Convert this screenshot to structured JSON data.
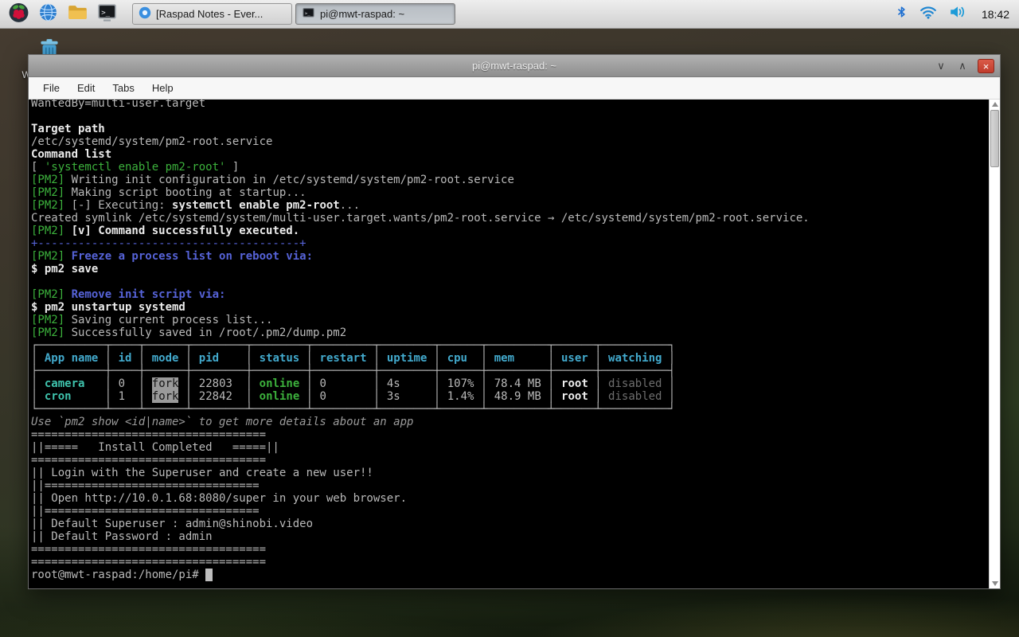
{
  "colors": {
    "terminal_bg": "#000000",
    "terminal_fg": "#b9b9b9",
    "green": "#3cb13c",
    "blue": "#5663d8",
    "cyan": "#42a9cc",
    "dim_gray": "#6e6e6e",
    "close_button_red": "#c03c2c",
    "taskbar_gray": "#d9d9d9"
  },
  "desktop": {
    "wastebasket_label": "Wastebasket"
  },
  "taskbar": {
    "clock": "18:42",
    "windows": [
      {
        "label": "[Raspad Notes - Ever...",
        "active": false
      },
      {
        "label": "pi@mwt-raspad: ~",
        "active": true
      }
    ]
  },
  "window": {
    "title": "pi@mwt-raspad: ~",
    "menu": [
      "File",
      "Edit",
      "Tabs",
      "Help"
    ],
    "controls": {
      "minimize": "∨",
      "maximize": "∧",
      "close": "×"
    }
  },
  "terminal": {
    "prompt": "root@mwt-raspad:/home/pi#",
    "lines": [
      [
        {
          "t": "WantedBy=multi-user.target"
        }
      ],
      [],
      [
        {
          "t": "Target path",
          "c": "bold"
        }
      ],
      [
        {
          "t": "/etc/systemd/system/pm2-root.service"
        }
      ],
      [
        {
          "t": "Command list",
          "c": "bold"
        }
      ],
      [
        {
          "t": "[ "
        },
        {
          "t": "'systemctl enable pm2-root'",
          "c": "grn"
        },
        {
          "t": " ]"
        }
      ],
      [
        {
          "t": "[PM2] ",
          "c": "grn"
        },
        {
          "t": "Writing init configuration in /etc/systemd/system/pm2-root.service"
        }
      ],
      [
        {
          "t": "[PM2] ",
          "c": "grn"
        },
        {
          "t": "Making script booting at startup..."
        }
      ],
      [
        {
          "t": "[PM2] ",
          "c": "grn"
        },
        {
          "t": "[-] Executing: "
        },
        {
          "t": "systemctl enable pm2-root",
          "c": "bold"
        },
        {
          "t": "..."
        }
      ],
      [
        {
          "t": "Created symlink /etc/systemd/system/multi-user.target.wants/pm2-root.service → /etc/systemd/system/pm2-root.service."
        }
      ],
      [
        {
          "t": "[PM2] ",
          "c": "grn"
        },
        {
          "t": "[v] Command successfully executed.",
          "c": "bold"
        }
      ],
      [
        {
          "t": "+---------------------------------------+",
          "c": "blu"
        }
      ],
      [
        {
          "t": "[PM2] ",
          "c": "grn"
        },
        {
          "t": "Freeze a process list on reboot via:",
          "c": "blub"
        }
      ],
      [
        {
          "t": "$ pm2 save",
          "c": "bold"
        }
      ],
      [],
      [
        {
          "t": "[PM2] ",
          "c": "grn"
        },
        {
          "t": "Remove init script via:",
          "c": "blub"
        }
      ],
      [
        {
          "t": "$ pm2 unstartup systemd",
          "c": "bold"
        }
      ],
      [
        {
          "t": "[PM2] ",
          "c": "grn"
        },
        {
          "t": "Saving current process list..."
        }
      ],
      [
        {
          "t": "[PM2] ",
          "c": "grn"
        },
        {
          "t": "Successfully saved in /root/.pm2/dump.pm2"
        }
      ],
      [
        {
          "t": "┌──────────┬────┬──────┬────────┬────────┬─────────┬────────┬──────┬─────────┬──────┬──────────┐"
        }
      ],
      [
        {
          "t": "│"
        },
        {
          "t": " App name ",
          "c": "cy"
        },
        {
          "t": "│"
        },
        {
          "t": " id ",
          "c": "cy"
        },
        {
          "t": "│"
        },
        {
          "t": " mode ",
          "c": "cy"
        },
        {
          "t": "│"
        },
        {
          "t": " pid    ",
          "c": "cy"
        },
        {
          "t": "│"
        },
        {
          "t": " status ",
          "c": "cy"
        },
        {
          "t": "│"
        },
        {
          "t": " restart ",
          "c": "cy"
        },
        {
          "t": "│"
        },
        {
          "t": " uptime ",
          "c": "cy"
        },
        {
          "t": "│"
        },
        {
          "t": " cpu  ",
          "c": "cy"
        },
        {
          "t": "│"
        },
        {
          "t": " mem     ",
          "c": "cy"
        },
        {
          "t": "│"
        },
        {
          "t": " user ",
          "c": "cy"
        },
        {
          "t": "│"
        },
        {
          "t": " watching ",
          "c": "cy"
        },
        {
          "t": "│"
        }
      ],
      [
        {
          "t": "├──────────┼────┼──────┼────────┼────────┼─────────┼────────┼──────┼─────────┼──────┼──────────┤"
        }
      ],
      [
        {
          "t": "│"
        },
        {
          "t": " camera   ",
          "c": "cyb"
        },
        {
          "t": "│"
        },
        {
          "t": " 0  "
        },
        {
          "t": "│"
        },
        {
          "t": " "
        },
        {
          "t": "fork",
          "c": "inv"
        },
        {
          "t": " "
        },
        {
          "t": "│"
        },
        {
          "t": " 22803  "
        },
        {
          "t": "│"
        },
        {
          "t": " "
        },
        {
          "t": "online",
          "c": "grnb"
        },
        {
          "t": " "
        },
        {
          "t": "│"
        },
        {
          "t": " 0       "
        },
        {
          "t": "│"
        },
        {
          "t": " 4s     "
        },
        {
          "t": "│"
        },
        {
          "t": " 107% "
        },
        {
          "t": "│"
        },
        {
          "t": " 78.4 MB "
        },
        {
          "t": "│"
        },
        {
          "t": " root ",
          "c": "bold"
        },
        {
          "t": "│"
        },
        {
          "t": " disabled ",
          "c": "dim"
        },
        {
          "t": "│"
        }
      ],
      [
        {
          "t": "│"
        },
        {
          "t": " cron     ",
          "c": "cyb"
        },
        {
          "t": "│"
        },
        {
          "t": " 1  "
        },
        {
          "t": "│"
        },
        {
          "t": " "
        },
        {
          "t": "fork",
          "c": "inv"
        },
        {
          "t": " "
        },
        {
          "t": "│"
        },
        {
          "t": " 22842  "
        },
        {
          "t": "│"
        },
        {
          "t": " "
        },
        {
          "t": "online",
          "c": "grnb"
        },
        {
          "t": " "
        },
        {
          "t": "│"
        },
        {
          "t": " 0       "
        },
        {
          "t": "│"
        },
        {
          "t": " 3s     "
        },
        {
          "t": "│"
        },
        {
          "t": " 1.4% "
        },
        {
          "t": "│"
        },
        {
          "t": " 48.9 MB "
        },
        {
          "t": "│"
        },
        {
          "t": " root ",
          "c": "bold"
        },
        {
          "t": "│"
        },
        {
          "t": " disabled ",
          "c": "dim"
        },
        {
          "t": "│"
        }
      ],
      [
        {
          "t": "└──────────┴────┴──────┴────────┴────────┴─────────┴────────┴──────┴─────────┴──────┴──────────┘"
        }
      ],
      [
        {
          "t": "Use `pm2 show <id|name>` to get more details about an app",
          "c": "ital"
        }
      ],
      [
        {
          "t": "==================================="
        }
      ],
      [
        {
          "t": "||=====   Install Completed   =====||"
        }
      ],
      [
        {
          "t": "==================================="
        }
      ],
      [
        {
          "t": "|| Login with the Superuser and create a new user!!"
        }
      ],
      [
        {
          "t": "||================================"
        }
      ],
      [
        {
          "t": "|| Open http://10.0.1.68:8080/super in your web browser."
        }
      ],
      [
        {
          "t": "||================================"
        }
      ],
      [
        {
          "t": "|| Default Superuser : admin@shinobi.video"
        }
      ],
      [
        {
          "t": "|| Default Password : admin"
        }
      ],
      [
        {
          "t": "==================================="
        }
      ],
      [
        {
          "t": "==================================="
        }
      ],
      [
        {
          "t": "root@mwt-raspad:/home/pi# "
        },
        {
          "t": " ",
          "c": "cursor"
        }
      ]
    ]
  }
}
